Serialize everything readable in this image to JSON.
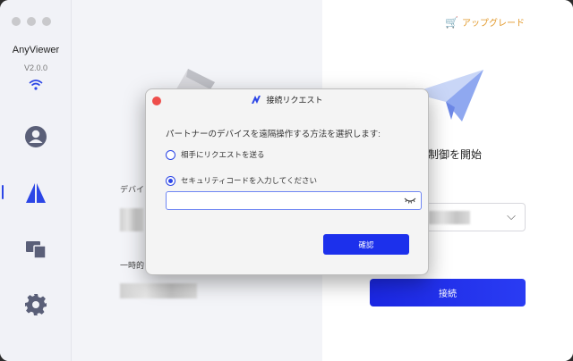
{
  "sidebar": {
    "app_name": "AnyViewer",
    "version": "V2.0.0",
    "nav": [
      "account",
      "connect",
      "devices",
      "settings"
    ]
  },
  "header": {
    "upgrade_label": "アップグレード"
  },
  "background": {
    "device_label": "デバイ",
    "temp_label": "一時的",
    "remote_title": "制御を開始",
    "connect_label": "接続"
  },
  "dialog": {
    "title": "接続リクエスト",
    "prompt": "パートナーのデバイスを遠隔操作する方法を選択します:",
    "options": [
      {
        "label": "相手にリクエストを送る",
        "checked": false
      },
      {
        "label": "セキュリティコードを入力してください",
        "checked": true
      }
    ],
    "code_value": "",
    "confirm_label": "確認"
  },
  "colors": {
    "accent": "#2c46e6",
    "upgrade": "#e29a2d",
    "close": "#ee4e4b"
  }
}
